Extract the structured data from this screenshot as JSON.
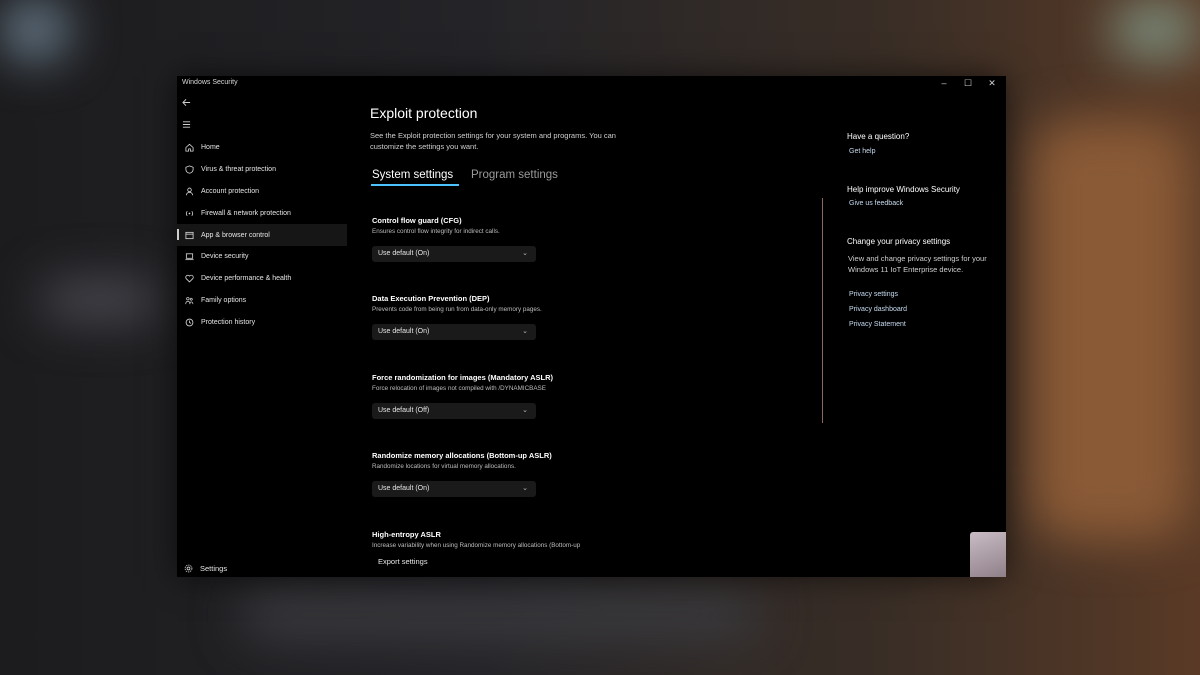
{
  "window": {
    "title": "Windows Security",
    "controls": [
      "–",
      "☐",
      "✕"
    ]
  },
  "nav": {
    "back_icon": "back-arrow-icon",
    "menu_icon": "hamburger-icon"
  },
  "sidebar": {
    "items": [
      {
        "label": "Home",
        "icon": "home-icon"
      },
      {
        "label": "Virus & threat protection",
        "icon": "shield-icon"
      },
      {
        "label": "Account protection",
        "icon": "person-icon"
      },
      {
        "label": "Firewall & network protection",
        "icon": "wifi-icon"
      },
      {
        "label": "App & browser control",
        "icon": "app-window-icon",
        "active": true
      },
      {
        "label": "Device security",
        "icon": "laptop-icon"
      },
      {
        "label": "Device performance & health",
        "icon": "heart-icon"
      },
      {
        "label": "Family options",
        "icon": "family-icon"
      },
      {
        "label": "Protection history",
        "icon": "history-icon"
      }
    ],
    "settings_label": "Settings"
  },
  "main": {
    "title": "Exploit protection",
    "description": "See the Exploit protection settings for your system and programs.  You can customize the settings you want.",
    "tabs": [
      {
        "label": "System settings",
        "selected": true
      },
      {
        "label": "Program settings",
        "selected": false
      }
    ],
    "options": [
      {
        "title": "Control flow guard (CFG)",
        "desc": "Ensures control flow integrity for indirect calls.",
        "value": "Use default (On)"
      },
      {
        "title": "Data Execution Prevention (DEP)",
        "desc": "Prevents code from being run from data-only memory pages.",
        "value": "Use default (On)"
      },
      {
        "title": "Force randomization for images (Mandatory ASLR)",
        "desc": "Force relocation of images not compiled with /DYNAMICBASE",
        "value": "Use default (Off)"
      },
      {
        "title": "Randomize memory allocations (Bottom-up ASLR)",
        "desc": "Randomize locations for virtual memory allocations.",
        "value": "Use default (On)"
      },
      {
        "title": "High-entropy ASLR",
        "desc": "Increase variability when using Randomize memory allocations (Bottom-up"
      }
    ],
    "export_label": "Export settings"
  },
  "right": {
    "question_heading": "Have a question?",
    "get_help": "Get help",
    "improve_heading": "Help improve Windows Security",
    "feedback": "Give us feedback",
    "privacy_heading": "Change your privacy settings",
    "privacy_text": "View and change privacy settings for your Windows 11 IoT Enterprise device.",
    "privacy_links": [
      "Privacy settings",
      "Privacy dashboard",
      "Privacy Statement"
    ]
  },
  "colors": {
    "accent": "#4cc2ff",
    "window_bg": "#000000",
    "link": "#c8dcf0"
  }
}
